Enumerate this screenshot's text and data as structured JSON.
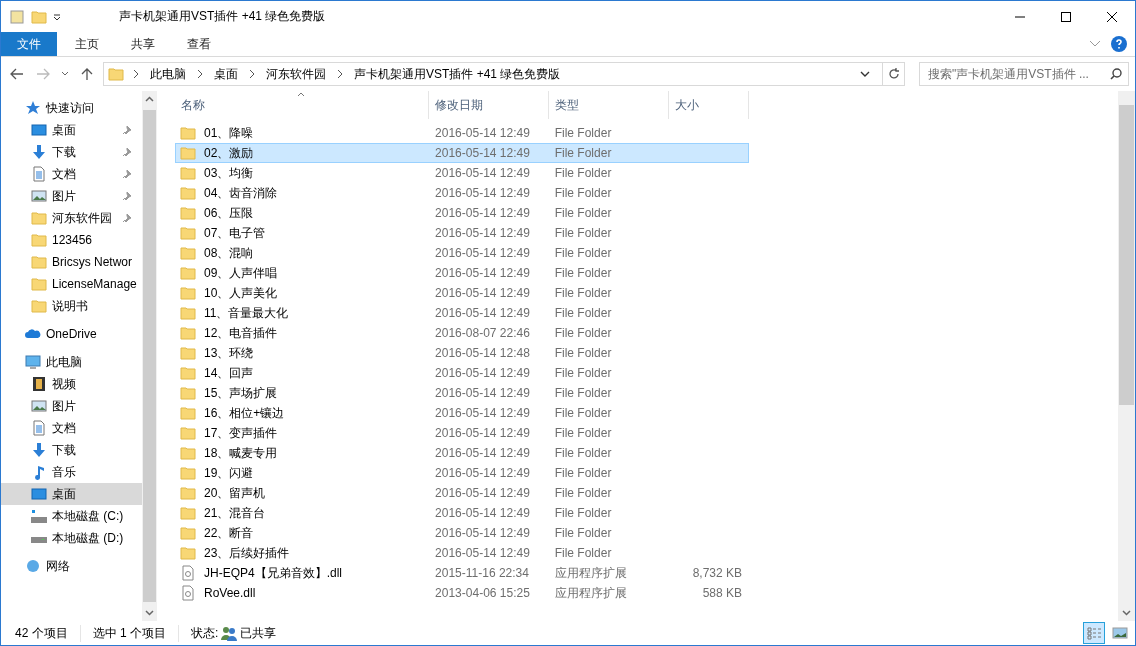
{
  "window": {
    "title": "声卡机架通用VST插件 +41 绿色免费版"
  },
  "ribbon": {
    "tabs": [
      {
        "label": "文件",
        "kind": "file"
      },
      {
        "label": "主页",
        "kind": "tab"
      },
      {
        "label": "共享",
        "kind": "tab"
      },
      {
        "label": "查看",
        "kind": "tab"
      }
    ]
  },
  "address_bar": {
    "crumbs": [
      "此电脑",
      "桌面",
      "河东软件园",
      "声卡机架通用VST插件 +41 绿色免费版"
    ]
  },
  "search": {
    "placeholder": "搜索\"声卡机架通用VST插件 ..."
  },
  "sidebar": {
    "groups": [
      {
        "label": "快速访问",
        "kind": "star",
        "selected": false,
        "children": [
          {
            "label": "桌面",
            "kind": "desktop",
            "pinned": true,
            "selected": false
          },
          {
            "label": "下载",
            "kind": "download",
            "pinned": true,
            "selected": false
          },
          {
            "label": "文档",
            "kind": "document",
            "pinned": true,
            "selected": false
          },
          {
            "label": "图片",
            "kind": "picture",
            "pinned": true,
            "selected": false
          },
          {
            "label": "河东软件园",
            "kind": "folder",
            "pinned": true,
            "selected": false
          },
          {
            "label": "123456",
            "kind": "folder",
            "pinned": false,
            "selected": false
          },
          {
            "label": "Bricsys Networ",
            "kind": "folder",
            "pinned": false,
            "selected": false
          },
          {
            "label": "LicenseManage",
            "kind": "folder",
            "pinned": false,
            "selected": false
          },
          {
            "label": "说明书",
            "kind": "folder",
            "pinned": false,
            "selected": false
          }
        ]
      },
      {
        "label": "OneDrive",
        "kind": "cloud",
        "selected": false
      },
      {
        "label": "此电脑",
        "kind": "pc",
        "selected": false,
        "children": [
          {
            "label": "视频",
            "kind": "video",
            "pinned": false,
            "selected": false
          },
          {
            "label": "图片",
            "kind": "picture",
            "pinned": false,
            "selected": false
          },
          {
            "label": "文档",
            "kind": "document",
            "pinned": false,
            "selected": false
          },
          {
            "label": "下载",
            "kind": "download",
            "pinned": false,
            "selected": false
          },
          {
            "label": "音乐",
            "kind": "music",
            "pinned": false,
            "selected": false
          },
          {
            "label": "桌面",
            "kind": "desktop",
            "pinned": false,
            "selected": true
          },
          {
            "label": "本地磁盘 (C:)",
            "kind": "system-drive",
            "pinned": false,
            "selected": false
          },
          {
            "label": "本地磁盘 (D:)",
            "kind": "drive",
            "pinned": false,
            "selected": false
          }
        ]
      },
      {
        "label": "网络",
        "kind": "network",
        "selected": false
      }
    ]
  },
  "table": {
    "columns": [
      "名称",
      "修改日期",
      "类型",
      "大小"
    ],
    "rows": [
      {
        "name": "01、降噪",
        "date": "2016-05-14 12:49",
        "type": "File Folder",
        "size": "",
        "kind": "folder",
        "selected": false
      },
      {
        "name": "02、激励",
        "date": "2016-05-14 12:49",
        "type": "File Folder",
        "size": "",
        "kind": "folder",
        "selected": true
      },
      {
        "name": "03、均衡",
        "date": "2016-05-14 12:49",
        "type": "File Folder",
        "size": "",
        "kind": "folder",
        "selected": false
      },
      {
        "name": "04、齿音消除",
        "date": "2016-05-14 12:49",
        "type": "File Folder",
        "size": "",
        "kind": "folder",
        "selected": false
      },
      {
        "name": "06、压限",
        "date": "2016-05-14 12:49",
        "type": "File Folder",
        "size": "",
        "kind": "folder",
        "selected": false
      },
      {
        "name": "07、电子管",
        "date": "2016-05-14 12:49",
        "type": "File Folder",
        "size": "",
        "kind": "folder",
        "selected": false
      },
      {
        "name": "08、混响",
        "date": "2016-05-14 12:49",
        "type": "File Folder",
        "size": "",
        "kind": "folder",
        "selected": false
      },
      {
        "name": "09、人声伴唱",
        "date": "2016-05-14 12:49",
        "type": "File Folder",
        "size": "",
        "kind": "folder",
        "selected": false
      },
      {
        "name": "10、人声美化",
        "date": "2016-05-14 12:49",
        "type": "File Folder",
        "size": "",
        "kind": "folder",
        "selected": false
      },
      {
        "name": "11、音量最大化",
        "date": "2016-05-14 12:49",
        "type": "File Folder",
        "size": "",
        "kind": "folder",
        "selected": false
      },
      {
        "name": "12、电音插件",
        "date": "2016-08-07 22:46",
        "type": "File Folder",
        "size": "",
        "kind": "folder",
        "selected": false
      },
      {
        "name": "13、环绕",
        "date": "2016-05-14 12:48",
        "type": "File Folder",
        "size": "",
        "kind": "folder",
        "selected": false
      },
      {
        "name": "14、回声",
        "date": "2016-05-14 12:49",
        "type": "File Folder",
        "size": "",
        "kind": "folder",
        "selected": false
      },
      {
        "name": "15、声场扩展",
        "date": "2016-05-14 12:49",
        "type": "File Folder",
        "size": "",
        "kind": "folder",
        "selected": false
      },
      {
        "name": "16、相位+镶边",
        "date": "2016-05-14 12:49",
        "type": "File Folder",
        "size": "",
        "kind": "folder",
        "selected": false
      },
      {
        "name": "17、变声插件",
        "date": "2016-05-14 12:49",
        "type": "File Folder",
        "size": "",
        "kind": "folder",
        "selected": false
      },
      {
        "name": "18、喊麦专用",
        "date": "2016-05-14 12:49",
        "type": "File Folder",
        "size": "",
        "kind": "folder",
        "selected": false
      },
      {
        "name": "19、闪避",
        "date": "2016-05-14 12:49",
        "type": "File Folder",
        "size": "",
        "kind": "folder",
        "selected": false
      },
      {
        "name": "20、留声机",
        "date": "2016-05-14 12:49",
        "type": "File Folder",
        "size": "",
        "kind": "folder",
        "selected": false
      },
      {
        "name": "21、混音台",
        "date": "2016-05-14 12:49",
        "type": "File Folder",
        "size": "",
        "kind": "folder",
        "selected": false
      },
      {
        "name": "22、断音",
        "date": "2016-05-14 12:49",
        "type": "File Folder",
        "size": "",
        "kind": "folder",
        "selected": false
      },
      {
        "name": "23、后续好插件",
        "date": "2016-05-14 12:49",
        "type": "File Folder",
        "size": "",
        "kind": "folder",
        "selected": false
      },
      {
        "name": "JH-EQP4【兄弟音效】.dll",
        "date": "2015-11-16 22:34",
        "type": "应用程序扩展",
        "size": "8,732 KB",
        "kind": "file",
        "selected": false
      },
      {
        "name": "RoVee.dll",
        "date": "2013-04-06 15:25",
        "type": "应用程序扩展",
        "size": "588 KB",
        "kind": "file",
        "selected": false
      }
    ]
  },
  "status_bar": {
    "item_count": "42 个项目",
    "selection": "选中 1 个项目",
    "state_label": "状态:",
    "state_value": "已共享",
    "views": [
      {
        "kind": "details",
        "selected": true
      },
      {
        "kind": "thumbnails",
        "selected": false
      }
    ]
  }
}
